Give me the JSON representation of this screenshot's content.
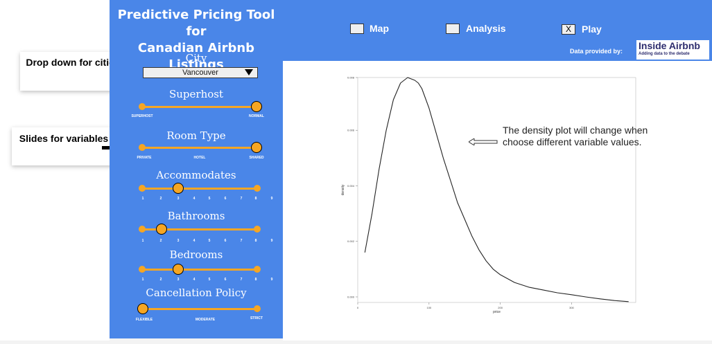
{
  "callouts": {
    "cities": "Drop down for cities",
    "variables": "Slides for variables"
  },
  "sidebar": {
    "title_line1": "Predictive Pricing Tool for",
    "title_line2": "Canadian Airbnb Listings",
    "city_label": "City",
    "city_value": "Vancouver",
    "superhost": {
      "label": "Superhost",
      "ticks": [
        "SUPERHOST",
        "NORMAL"
      ],
      "selected": "NORMAL"
    },
    "room_type": {
      "label": "Room Type",
      "ticks": [
        "PRIVATE",
        "HOTEL",
        "SHARED"
      ],
      "selected": "SHARED"
    },
    "accommodates": {
      "label": "Accommodates",
      "ticks": [
        "1",
        "2",
        "3",
        "4",
        "5",
        "6",
        "7",
        "8",
        "9"
      ],
      "value": 3
    },
    "bathrooms": {
      "label": "Bathrooms",
      "ticks": [
        "1",
        "2",
        "3",
        "4",
        "5",
        "6",
        "7",
        "8",
        "9"
      ],
      "value": 2
    },
    "bedrooms": {
      "label": "Bedrooms",
      "ticks": [
        "1",
        "2",
        "3",
        "4",
        "5",
        "6",
        "7",
        "8",
        "9"
      ],
      "value": 3
    },
    "cancellation": {
      "label": "Cancellation Policy",
      "ticks": [
        "FLEXIBLE",
        "MODERATE",
        "STRICT"
      ],
      "selected": "FLEXIBLE"
    },
    "accent_color": "#f6a623",
    "panel_color": "#4a86e8"
  },
  "nav": {
    "map_label": "Map",
    "analysis_label": "Analysis",
    "play_label": "Play",
    "play_mark": "X",
    "provided_by": "Data provided by:",
    "logo_main": "Inside Airbnb",
    "logo_sub": "Adding data to the debate"
  },
  "annotation": "The density plot will change when choose different variable values.",
  "chart_data": {
    "type": "line",
    "xlabel": "price",
    "ylabel": "density",
    "xlim": [
      0,
      390
    ],
    "ylim": [
      0,
      0.0081
    ],
    "x_ticks": [
      "0",
      "100",
      "200",
      "300"
    ],
    "y_ticks": [
      "0.000",
      "0.002",
      "0.004",
      "0.006",
      "0.008"
    ],
    "y_tick_values": [
      0.0002,
      0.0022,
      0.0042,
      0.0062,
      0.0081
    ],
    "series": [
      {
        "x": [
          10,
          20,
          30,
          40,
          50,
          60,
          70,
          80,
          85,
          90,
          100,
          110,
          120,
          130,
          140,
          150,
          160,
          170,
          180,
          190,
          200,
          220,
          240,
          260,
          280,
          300,
          320,
          340,
          360,
          380
        ],
        "values": [
          0.0018,
          0.0032,
          0.0048,
          0.0062,
          0.0073,
          0.0079,
          0.0081,
          0.008,
          0.0079,
          0.0077,
          0.007,
          0.0061,
          0.0052,
          0.0044,
          0.0036,
          0.003,
          0.0024,
          0.0019,
          0.0015,
          0.0012,
          0.001,
          0.00072,
          0.00055,
          0.00045,
          0.00035,
          0.00028,
          0.0002,
          0.00013,
          7e-05,
          3e-05
        ]
      }
    ]
  }
}
